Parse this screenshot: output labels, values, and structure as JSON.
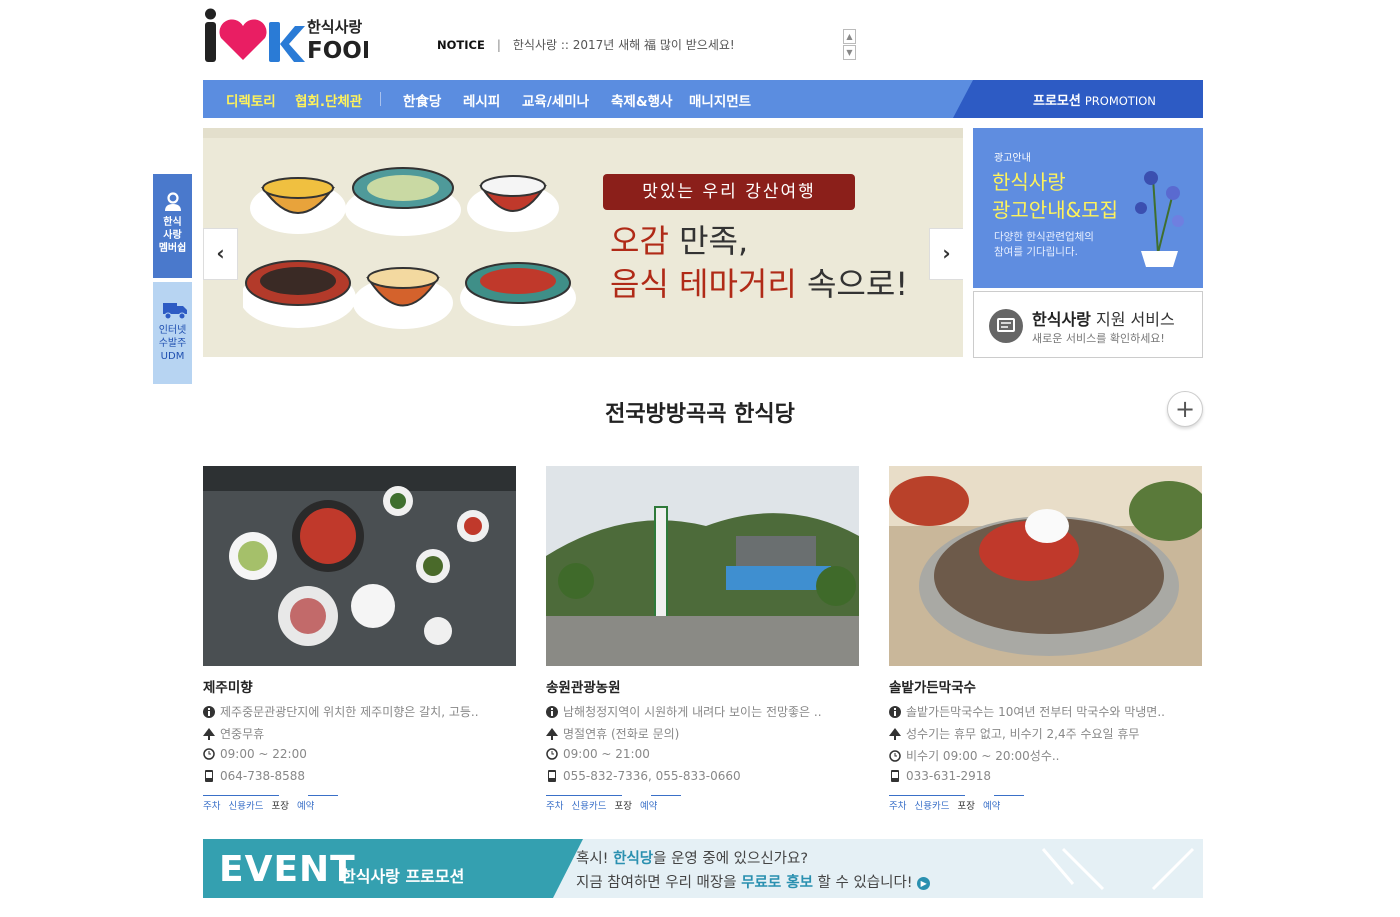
{
  "header": {
    "logo_text": "I ♥ K 한식사랑 FOOD",
    "notice_label": "NOTICE",
    "notice_text": "한식사랑 :: 2017년 새해 福 많이 받으세요!"
  },
  "nav": {
    "items": [
      "디렉토리",
      "협회.단체관",
      "한食당",
      "레시피",
      "교육/세미나",
      "축제&행사",
      "매니지먼트"
    ],
    "promo_label": "프로모션",
    "promo_en": "PROMOTION"
  },
  "side": {
    "membership": [
      "한식",
      "사랑",
      "멤버쉽"
    ],
    "delivery": [
      "인터넷",
      "수발주",
      "UDM"
    ]
  },
  "banner": {
    "tagline": "맛있는 우리 강산여행",
    "line1_red": "오감",
    "line1_rest": " 만족,",
    "line2_red": "음식 테마거리",
    "line2_rest": " 속으로!"
  },
  "ad": {
    "small": "광고안내",
    "title1": "한식사랑",
    "title2": "광고안내&모집",
    "desc1": "다양한 한식관련업체의",
    "desc2": "참여를 기다립니다.",
    "service_bold": "한식사랑",
    "service_rest": " 지원 서비스",
    "service_sub": "새로운 서비스를 확인하세요!"
  },
  "section": {
    "title": "전국방방곡곡 한식당"
  },
  "restaurants": [
    {
      "name": "제주미향",
      "desc": "제주중문관광단지에 위치한 제주미향은 갈치, 고등..",
      "holiday": "연중무휴",
      "hours": "09:00 ~ 22:00",
      "phone": "064-738-8588",
      "tags": [
        "주차",
        "신용카드",
        "포장",
        "예약"
      ]
    },
    {
      "name": "송원관광농원",
      "desc": "남해청정지역이 시원하게 내려다 보이는 전망좋은 ..",
      "holiday": "명절연휴 (전화로 문의)",
      "hours": "09:00 ~ 21:00",
      "phone": "055-832-7336, 055-833-0660",
      "tags": [
        "주차",
        "신용카드",
        "포장",
        "예약"
      ]
    },
    {
      "name": "솔밭가든막국수",
      "desc": "솔밭가든막국수는 10여년 전부터 막국수와 막냉면..",
      "holiday": "성수기는 휴무 없고, 비수기 2,4주 수요일 휴무",
      "hours": "비수기 09:00 ~ 20:00성수..",
      "phone": "033-631-2918",
      "tags": [
        "주차",
        "신용카드",
        "포장",
        "예약"
      ]
    }
  ],
  "event": {
    "logo": "EVENT",
    "sub": "한식사랑 프로모션",
    "q_pre": "혹시! ",
    "q_em": "한식당",
    "q_post": "을 운영 중에 있으신가요?",
    "c_pre": "지금 참여하면 우리 매장을 ",
    "c_em": "무료로 홍보",
    "c_post": " 할 수 있습니다!"
  },
  "colors": {
    "nav": "#5b8de0",
    "promo": "#2d5bc4",
    "accent_yellow": "#fff35a",
    "banner_red": "#b02a17",
    "event_teal": "#34a0b0"
  }
}
